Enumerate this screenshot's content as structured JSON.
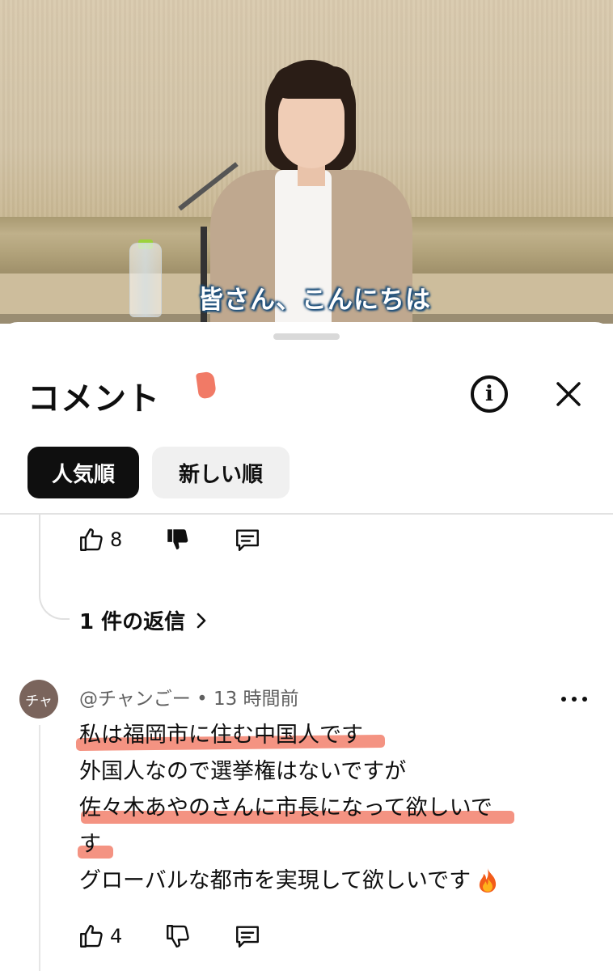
{
  "video": {
    "subtitle": "皆さん、こんにちは"
  },
  "sheet": {
    "title": "コメント",
    "info_icon": "info-icon",
    "close_icon": "close-icon",
    "sort_tabs": [
      {
        "label": "人気順",
        "active": true
      },
      {
        "label": "新しい順",
        "active": false
      }
    ]
  },
  "previous_comment": {
    "likes": "8",
    "disliked": true,
    "replies_label": "1 件の返信"
  },
  "comment": {
    "avatar_text": "チャ",
    "meta": "@チャンごー • 13 時間前",
    "lines": [
      "私は福岡市に住む中国人です",
      "外国人なので選挙権はないですが",
      "佐々木あやのさんに市長になって欲しいで",
      "す",
      "グローバルな都市を実現して欲しいです"
    ],
    "emoji": "fire-emoji",
    "likes": "4"
  },
  "colors": {
    "highlight": "#f2806c",
    "chip_active": "#0f0f0f",
    "chip_inactive": "#f0f0f0",
    "subtitle_outline": "#1e4f7a"
  }
}
